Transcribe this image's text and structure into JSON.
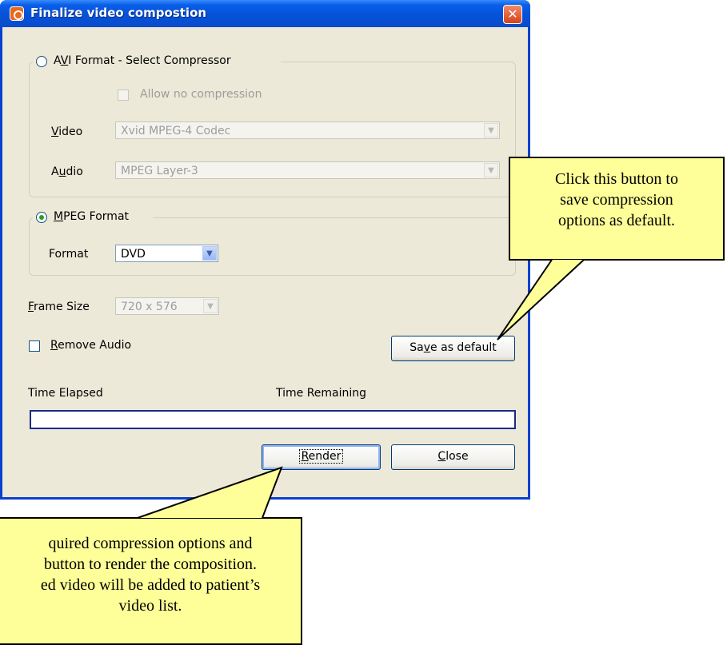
{
  "window": {
    "title": "Finalize video compostion",
    "close_glyph": "✕"
  },
  "avi": {
    "group_label_pre": "A",
    "group_label_key": "V",
    "group_label_post": "I Format - Select Compressor",
    "selected": false,
    "allow_no_compression": "Allow no compression",
    "video_key": "V",
    "video_rest": "ideo",
    "video_value": "Xvid MPEG-4 Codec",
    "audio_pre": "A",
    "audio_key": "u",
    "audio_post": "dio",
    "audio_value": "MPEG Layer-3"
  },
  "mpeg": {
    "group_label_key": "M",
    "group_label_rest": "PEG Format",
    "selected": true,
    "format_label": "Format",
    "format_value": "DVD"
  },
  "frame_size": {
    "label_key": "F",
    "label_rest": "rame Size",
    "value": "720 x 576"
  },
  "remove_audio": {
    "label_key": "R",
    "label_rest": "emove Audio",
    "checked": false
  },
  "save_default": {
    "pre": "Sa",
    "key": "v",
    "post": "e as default"
  },
  "time": {
    "elapsed_label": "Time Elapsed",
    "remaining_label": "Time Remaining"
  },
  "progress": {
    "value": 0
  },
  "buttons": {
    "render_key": "R",
    "render_rest": "ender",
    "close_key": "C",
    "close_rest": "lose"
  },
  "callouts": {
    "save": [
      "Click this button to",
      "save compression",
      "options as default."
    ],
    "render": [
      "quired compression options and",
      "button to render the composition.",
      "ed video will be added to patient’s",
      "video list."
    ]
  },
  "colors": {
    "titlebar": "#0552d8",
    "window_bg": "#ece9d8",
    "callout_bg": "#ffff99",
    "progress_border": "#1a2a8c"
  }
}
